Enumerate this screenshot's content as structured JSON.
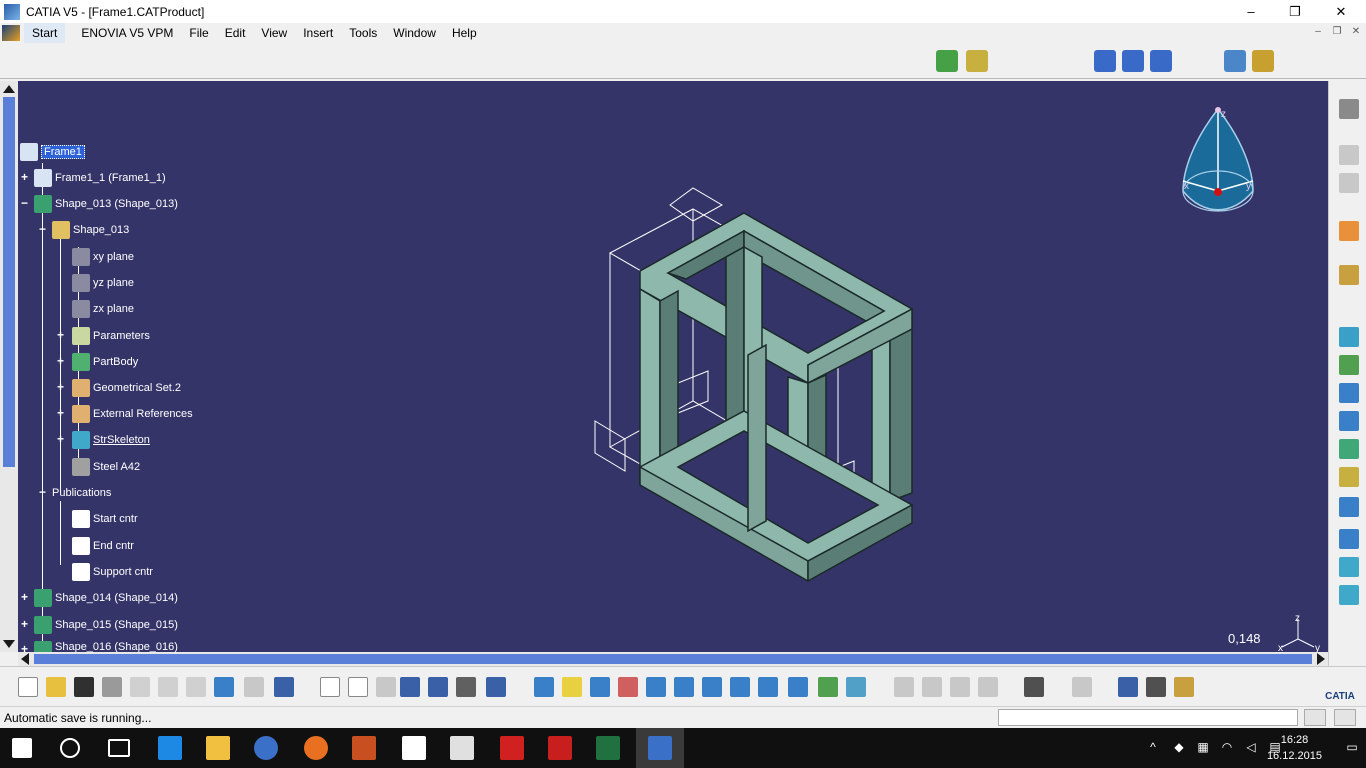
{
  "window": {
    "title": "CATIA V5 - [Frame1.CATProduct]",
    "controls": {
      "minimize": "–",
      "maximize": "❐",
      "close": "✕"
    }
  },
  "menu": {
    "items": [
      "Start",
      "ENOVIA V5 VPM",
      "File",
      "Edit",
      "View",
      "Insert",
      "Tools",
      "Window",
      "Help"
    ]
  },
  "tree": {
    "root": "Frame1",
    "nodes": [
      {
        "label": "Frame1_1 (Frame1_1)",
        "expander": "+"
      },
      {
        "label": "Shape_013 (Shape_013)",
        "expander": "−"
      },
      {
        "label": "Shape_013",
        "expander": "−"
      },
      {
        "label": "xy plane"
      },
      {
        "label": "yz plane"
      },
      {
        "label": "zx plane"
      },
      {
        "label": "Parameters",
        "expander": "+"
      },
      {
        "label": "PartBody",
        "expander": "+"
      },
      {
        "label": "Geometrical Set.2",
        "expander": "+"
      },
      {
        "label": "External References",
        "expander": "+"
      },
      {
        "label": "StrSkeleton",
        "expander": "+"
      },
      {
        "label": "Steel A42"
      },
      {
        "label": "Publications",
        "expander": "−"
      },
      {
        "label": "Start cntr"
      },
      {
        "label": "End cntr"
      },
      {
        "label": "Support cntr"
      },
      {
        "label": "Shape_014 (Shape_014)",
        "expander": "+"
      },
      {
        "label": "Shape_015 (Shape_015)",
        "expander": "+"
      },
      {
        "label": "Shape_016 (Shape_016)",
        "expander": "+"
      }
    ]
  },
  "viewport": {
    "background": "#353469",
    "frame_color": "#7fa59b",
    "zoom": "0,148",
    "compass": {
      "z": "z",
      "x": "x",
      "y": "y"
    },
    "axis_triad": {
      "z": "z",
      "x": "x",
      "y": "y"
    }
  },
  "status": {
    "message": "Automatic save is running..."
  },
  "brand": "CATIA",
  "taskbar": {
    "time": "16:28",
    "date": "16.12.2015"
  }
}
